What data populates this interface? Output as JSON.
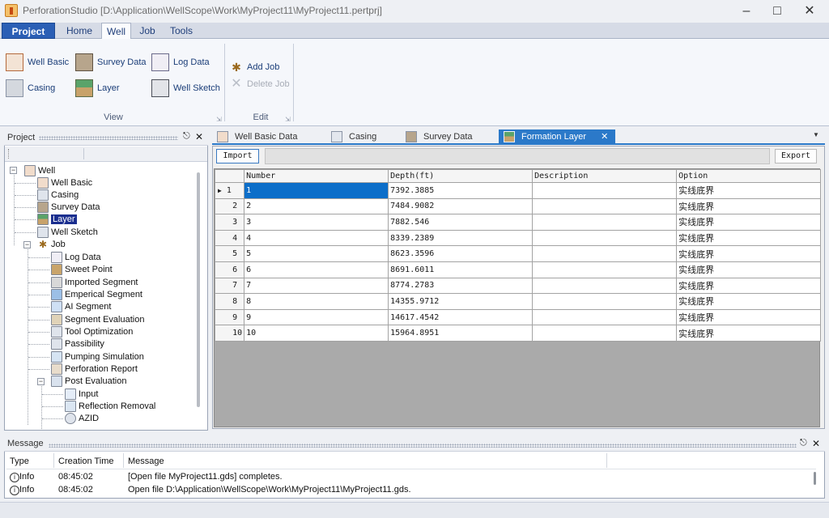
{
  "window": {
    "title": "PerforationStudio [D:\\Application\\WellScope\\Work\\MyProject11\\MyProject11.pertprj]"
  },
  "ribbon_tabs": [
    "Project",
    "Home",
    "Well",
    "Job",
    "Tools"
  ],
  "ribbon": {
    "view_group": {
      "label": "View",
      "buttons": [
        "Well Basic",
        "Survey Data",
        "Log Data",
        "Casing",
        "Layer",
        "Well Sketch"
      ]
    },
    "edit_group": {
      "label": "Edit",
      "buttons": [
        "Add Job",
        "Delete Job"
      ]
    }
  },
  "project_panel": {
    "title": "Project",
    "tree": [
      "Well",
      "Well Basic",
      "Casing",
      "Survey Data",
      "Layer",
      "Well Sketch",
      "Job",
      "Log Data",
      "Sweet Point",
      "Imported Segment",
      "Emperical Segment",
      "AI Segment",
      "Segment Evaluation",
      "Tool Optimization",
      "Passibility",
      "Pumping Simulation",
      "Perforation Report",
      "Post Evaluation",
      "Input",
      "Reflection Removal",
      "AZID"
    ]
  },
  "doc_tabs": [
    "Well Basic Data",
    "Casing",
    "Survey Data",
    "Formation Layer"
  ],
  "formation": {
    "import_label": "Import",
    "export_label": "Export",
    "columns": [
      "Number",
      "Depth(ft)",
      "Description",
      "Option"
    ],
    "rows": [
      [
        "1",
        "1",
        "7392.3885",
        "",
        "实线底界"
      ],
      [
        "2",
        "2",
        "7484.9082",
        "",
        "实线底界"
      ],
      [
        "3",
        "3",
        "7882.546",
        "",
        "实线底界"
      ],
      [
        "4",
        "4",
        "8339.2389",
        "",
        "实线底界"
      ],
      [
        "5",
        "5",
        "8623.3596",
        "",
        "实线底界"
      ],
      [
        "6",
        "6",
        "8691.6011",
        "",
        "实线底界"
      ],
      [
        "7",
        "7",
        "8774.2783",
        "",
        "实线底界"
      ],
      [
        "8",
        "8",
        "14355.9712",
        "",
        "实线底界"
      ],
      [
        "9",
        "9",
        "14617.4542",
        "",
        "实线底界"
      ],
      [
        "10",
        "10",
        "15964.8951",
        "",
        "实线底界"
      ]
    ]
  },
  "message_panel": {
    "title": "Message",
    "columns": [
      "Type",
      "Creation Time",
      "Message"
    ],
    "rows": [
      [
        "Info",
        "08:45:02",
        "[Open file MyProject11.gds] completes."
      ],
      [
        "Info",
        "08:45:02",
        "Open file D:\\Application\\WellScope\\Work\\MyProject11\\MyProject11.gds."
      ]
    ]
  },
  "colors": {
    "accent": "#2b79c9",
    "project_tab": "#2b5fb5",
    "selection": "#0c6ec9"
  }
}
